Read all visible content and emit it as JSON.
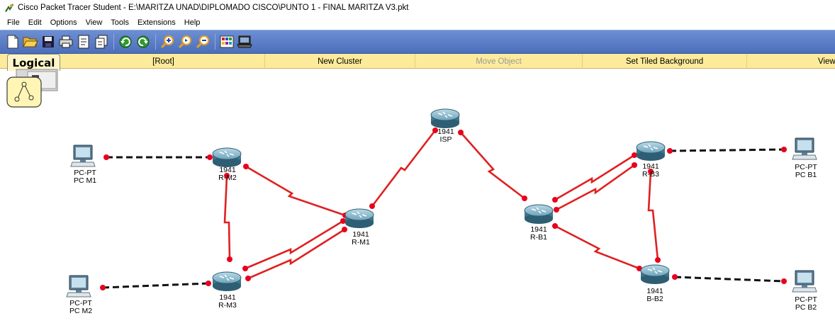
{
  "window": {
    "title": "Cisco Packet Tracer Student - E:\\MARITZA UNAD\\DIPLOMADO CISCO\\PUNTO 1 - FINAL MARITZA V3.pkt"
  },
  "menu": [
    "File",
    "Edit",
    "Options",
    "View",
    "Tools",
    "Extensions",
    "Help"
  ],
  "toolbar": {
    "buttons": [
      "new-icon",
      "open-icon",
      "save-icon",
      "print-icon",
      "activity-wizard-icon",
      "copy-icon",
      "undo-icon",
      "redo-icon",
      "zoom-in-icon",
      "zoom-reset-icon",
      "zoom-out-icon",
      "palette-icon",
      "custom-device-icon"
    ]
  },
  "workspace": {
    "tab_label": "Logical",
    "root": "[Root]",
    "new_cluster": "New Cluster",
    "move_object": "Move Object",
    "set_tiled_background": "Set Tiled Background",
    "viewport": "Viewport"
  },
  "devices": {
    "pc_m1": {
      "model": "PC-PT",
      "name": "PC M1"
    },
    "pc_m2": {
      "model": "PC-PT",
      "name": "PC M2"
    },
    "pc_b1": {
      "model": "PC-PT",
      "name": "PC B1"
    },
    "pc_b2": {
      "model": "PC-PT",
      "name": "PC B2"
    },
    "r_m1": {
      "model": "1941",
      "name": "R-M1"
    },
    "r_m2": {
      "model": "1941",
      "name": "R-M2"
    },
    "r_m3": {
      "model": "1941",
      "name": "R-M3"
    },
    "isp": {
      "model": "1941",
      "name": "ISP"
    },
    "r_b1": {
      "model": "1941",
      "name": "R-B1"
    },
    "r_b3": {
      "model": "1941",
      "name": "R-B3"
    },
    "b_b2": {
      "model": "1941",
      "name": "B-B2"
    }
  },
  "links": [
    {
      "from": "PC M1",
      "to": "R-M2",
      "type": "copper-straight"
    },
    {
      "from": "PC M2",
      "to": "R-M3",
      "type": "copper-straight"
    },
    {
      "from": "PC B1",
      "to": "R-B3",
      "type": "copper-straight"
    },
    {
      "from": "PC B2",
      "to": "B-B2",
      "type": "copper-straight"
    },
    {
      "from": "R-M2",
      "to": "R-M1",
      "type": "serial"
    },
    {
      "from": "R-M2",
      "to": "R-M3",
      "type": "serial"
    },
    {
      "from": "R-M3",
      "to": "R-M1",
      "type": "serial"
    },
    {
      "from": "R-M3",
      "to": "R-M1",
      "type": "serial"
    },
    {
      "from": "R-M1",
      "to": "ISP",
      "type": "serial"
    },
    {
      "from": "ISP",
      "to": "R-B1",
      "type": "serial"
    },
    {
      "from": "R-B1",
      "to": "R-B3",
      "type": "serial"
    },
    {
      "from": "R-B1",
      "to": "R-B3",
      "type": "serial"
    },
    {
      "from": "R-B1",
      "to": "B-B2",
      "type": "serial"
    },
    {
      "from": "R-B3",
      "to": "B-B2",
      "type": "serial"
    }
  ],
  "colors": {
    "toolbar": "#5a7cc6",
    "workspace_bar": "#fdeb9b",
    "serial_link": "#e02020",
    "copper_link": "#111111",
    "link_status_dot": "#e8001c"
  }
}
